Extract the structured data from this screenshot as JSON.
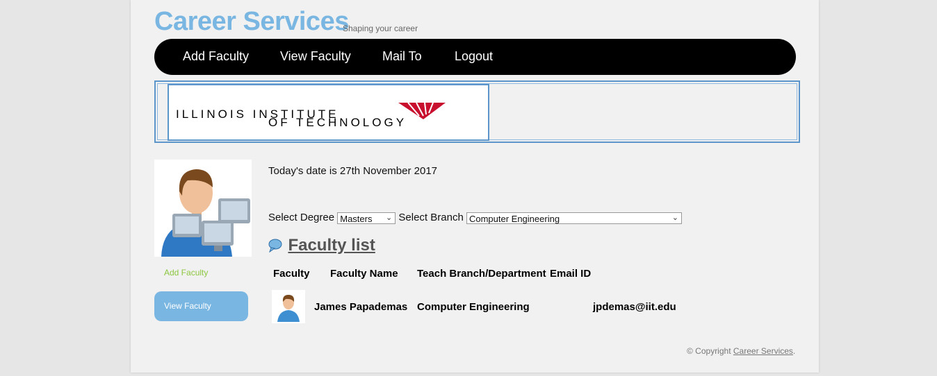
{
  "header": {
    "title": "Career Services",
    "tagline": "Shaping your career"
  },
  "nav": {
    "items": [
      {
        "label": "Add Faculty"
      },
      {
        "label": "View Faculty"
      },
      {
        "label": "Mail To"
      },
      {
        "label": "Logout"
      }
    ]
  },
  "banner": {
    "logo_line1": "ILLINOIS INSTITUTE",
    "logo_line2": "OF TECHNOLOGY"
  },
  "sidebar": {
    "add_label": "Add Faculty",
    "view_label": "View Faculty"
  },
  "main": {
    "date_text": "Today's date is 27th November 2017",
    "degree_label": "Select Degree",
    "degree_value": "Masters",
    "branch_label": "Select Branch",
    "branch_value": "Computer Engineering",
    "list_title": "Faculty list",
    "columns": [
      "Faculty",
      "Faculty Name",
      "Teach Branch/Department",
      "Email ID"
    ],
    "rows": [
      {
        "name": "James Papademas",
        "branch": "Computer Engineering",
        "email": "jpdemas@iit.edu"
      }
    ]
  },
  "footer": {
    "prefix": "© Copyright",
    "link": "Career Services",
    "suffix": "."
  },
  "colors": {
    "brand": "#7ab6e2",
    "nav_bg": "#000000",
    "accent_green": "#8cc63f",
    "banner_border": "#5c95c9"
  }
}
